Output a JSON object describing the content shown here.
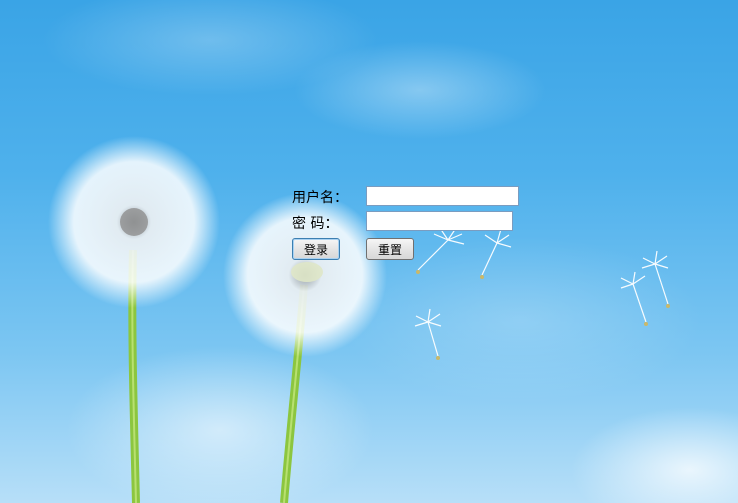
{
  "login_form": {
    "username_label": "用户名：",
    "password_label": "密 码：",
    "username_value": "",
    "password_value": "",
    "login_button": "登录",
    "reset_button": "重置"
  },
  "background": {
    "image": "dandelion-sky",
    "sky_color": "#3aa4e6"
  }
}
